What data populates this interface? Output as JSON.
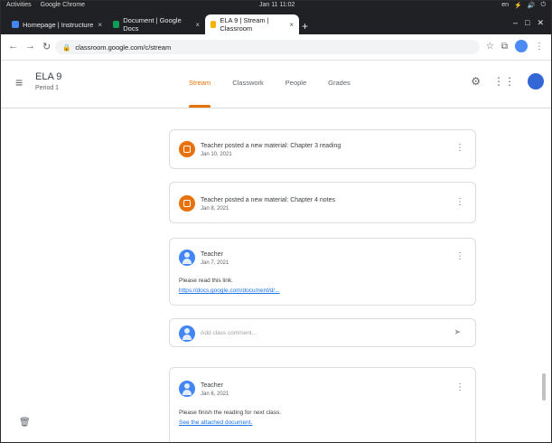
{
  "os": {
    "left": [
      "Activities",
      "Google Chrome"
    ],
    "clock": "Jan 11 11:02",
    "right": [
      "en",
      "⚡",
      "🔊",
      "⏻"
    ]
  },
  "browser": {
    "tabs": [
      {
        "label": "Homepage | Instructure",
        "fav": "blue"
      },
      {
        "label": "Document | Google Docs",
        "fav": "green"
      },
      {
        "label": "ELA 9 | Stream | Classroom",
        "fav": "orange",
        "active": true
      }
    ],
    "url": "classroom.google.com/c/stream",
    "url_icon": "lock-icon"
  },
  "classroom": {
    "class_name": "ELA 9",
    "class_section": "Period 1",
    "tabs": [
      "Stream",
      "Classwork",
      "People",
      "Grades"
    ],
    "active_tab": "Stream"
  },
  "stream": {
    "posts": [
      {
        "type": "assignment",
        "title": "Teacher posted a new material: Chapter 3 reading",
        "date": "Jan 10, 2021"
      },
      {
        "type": "assignment",
        "title": "Teacher posted a new material: Chapter 4 notes",
        "date": "Jan 8, 2021"
      },
      {
        "type": "announcement",
        "author": "Teacher",
        "date": "Jan 7, 2021",
        "text": "Please read this link.",
        "link": "https://docs.google.com/document/d/..."
      },
      {
        "type": "comment",
        "placeholder": "Add class comment..."
      },
      {
        "type": "announcement",
        "author": "Teacher",
        "date": "Jan 6, 2021",
        "text": "Please finish the reading for next class.",
        "link": "See the attached document."
      }
    ]
  }
}
